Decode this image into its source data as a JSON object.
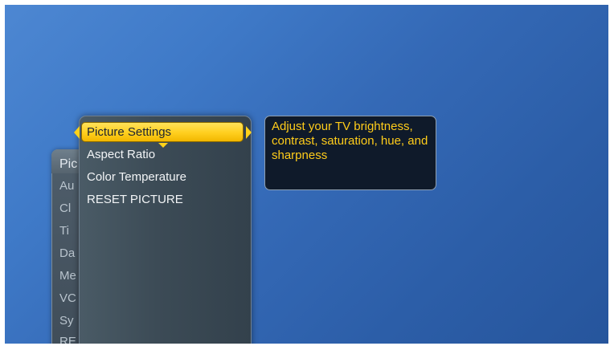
{
  "back_menu": {
    "items": [
      "Pic",
      "Au",
      "Cl",
      "Ti",
      "Da",
      "Me",
      "VC",
      "Sy",
      "RE"
    ]
  },
  "submenu": {
    "items": [
      "Picture Settings",
      "Aspect Ratio",
      "Color Temperature",
      "RESET PICTURE"
    ],
    "selected_index": 0
  },
  "tooltip": {
    "text": "Adjust your TV brightness, contrast, saturation, hue, and sharpness"
  },
  "colors": {
    "background": "#3a72c0",
    "highlight": "#ffd21a",
    "tooltip_text": "#ffcc1a",
    "panel": "#3c4b56"
  }
}
